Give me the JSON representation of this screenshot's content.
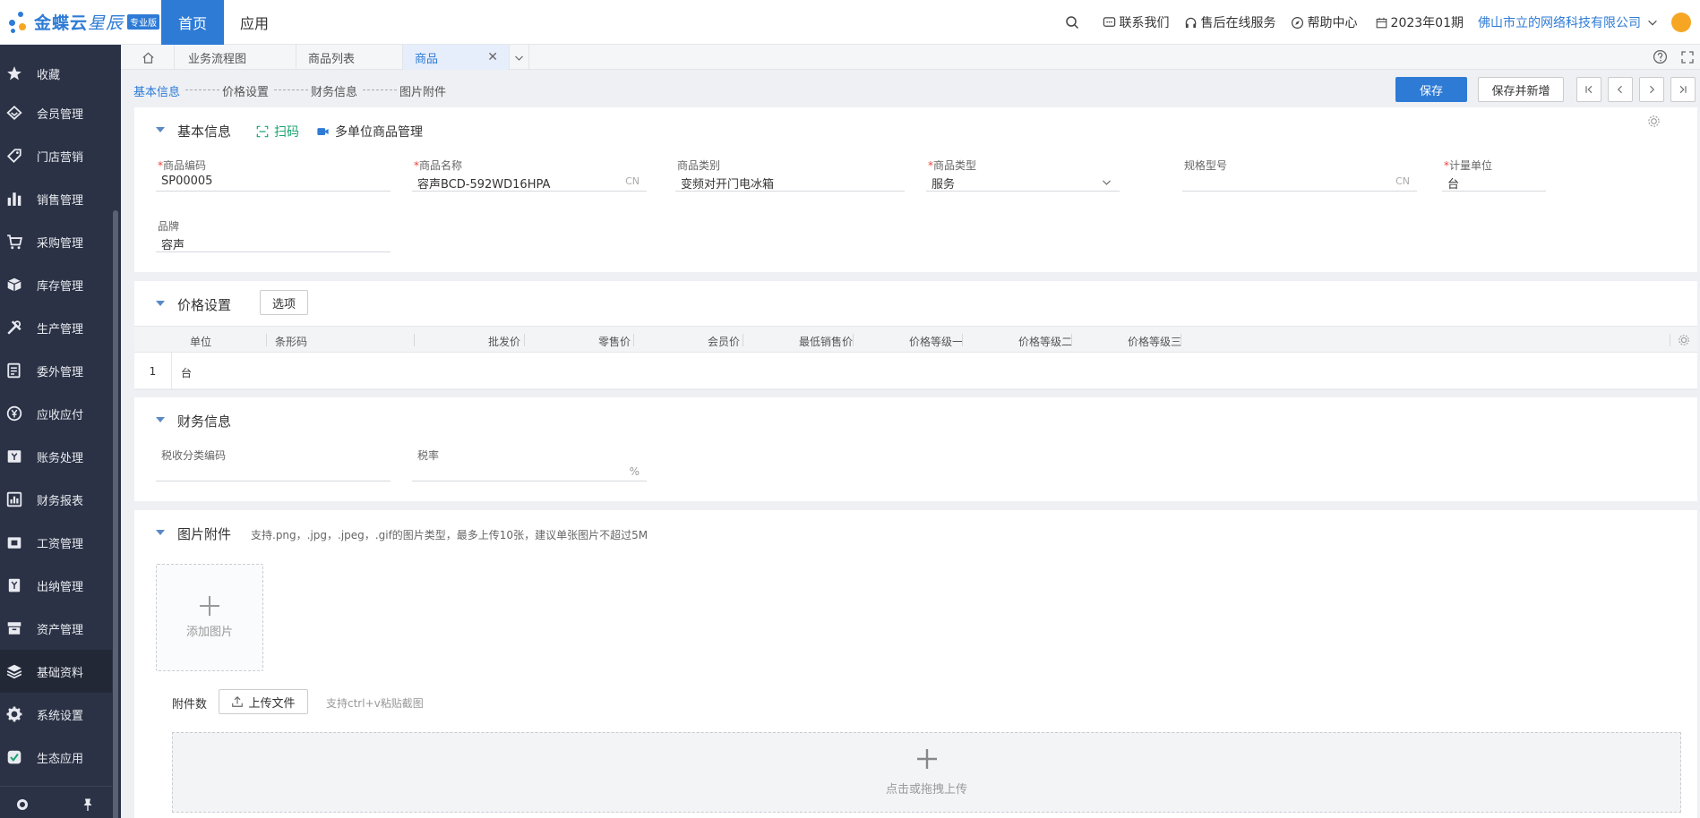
{
  "header": {
    "logo_text": "金蝶云",
    "logo_star": "星辰",
    "logo_badge": "专业版",
    "nav_home": "首页",
    "nav_app": "应用",
    "contact": "联系我们",
    "service": "售后在线服务",
    "help": "帮助中心",
    "period": "2023年01期",
    "company": "佛山市立的网络科技有限公司"
  },
  "sidebar": {
    "items": [
      {
        "label": "收藏",
        "icon": "star-icon"
      },
      {
        "label": "会员管理",
        "icon": "member-icon"
      },
      {
        "label": "门店营销",
        "icon": "tag-icon"
      },
      {
        "label": "销售管理",
        "icon": "bar-chart-icon"
      },
      {
        "label": "采购管理",
        "icon": "cart-icon"
      },
      {
        "label": "库存管理",
        "icon": "box-icon"
      },
      {
        "label": "生产管理",
        "icon": "tools-icon"
      },
      {
        "label": "委外管理",
        "icon": "document-icon"
      },
      {
        "label": "应收应付",
        "icon": "yen-coin-icon"
      },
      {
        "label": "账务处理",
        "icon": "ledger-icon"
      },
      {
        "label": "财务报表",
        "icon": "report-icon"
      },
      {
        "label": "工资管理",
        "icon": "wallet-icon"
      },
      {
        "label": "出纳管理",
        "icon": "cashier-icon"
      },
      {
        "label": "资产管理",
        "icon": "archive-icon"
      },
      {
        "label": "基础资料",
        "icon": "layers-icon"
      },
      {
        "label": "系统设置",
        "icon": "gear-icon"
      },
      {
        "label": "生态应用",
        "icon": "ecology-icon"
      }
    ],
    "active_index": 14
  },
  "tabs": [
    {
      "label": "业务流程图"
    },
    {
      "label": "商品列表"
    },
    {
      "label": "商品"
    }
  ],
  "steps": [
    "基本信息",
    "价格设置",
    "财务信息",
    "图片附件"
  ],
  "toolbar": {
    "save": "保存",
    "save_new": "保存并新增"
  },
  "basic": {
    "title": "基本信息",
    "scan": "扫码",
    "multi_unit": "多单位商品管理",
    "fields": {
      "code_label": "商品编码",
      "code_value": "SP00005",
      "name_label": "商品名称",
      "name_value": "容声BCD-592WD16HPA",
      "name_suffix": "CN",
      "category_label": "商品类别",
      "category_value": "变频对开门电冰箱",
      "type_label": "商品类型",
      "type_value": "服务",
      "spec_label": "规格型号",
      "spec_value": "",
      "spec_suffix": "CN",
      "unit_label": "计量单位",
      "unit_value": "台",
      "brand_label": "品牌",
      "brand_value": "容声"
    }
  },
  "price": {
    "title": "价格设置",
    "options": "选项",
    "columns": [
      "单位",
      "条形码",
      "批发价",
      "零售价",
      "会员价",
      "最低销售价",
      "价格等级一",
      "价格等级二",
      "价格等级三"
    ],
    "rows": [
      {
        "index": "1",
        "unit": "台"
      }
    ]
  },
  "finance": {
    "title": "财务信息",
    "tax_code_label": "税收分类编码",
    "tax_code_value": "",
    "tax_rate_label": "税率",
    "tax_rate_suffix": "%"
  },
  "images": {
    "title": "图片附件",
    "hint": "支持.png，.jpg，.jpeg，.gif的图片类型，最多上传10张，建议单张图片不超过5M",
    "add_image": "添加图片",
    "attach_label": "附件数",
    "upload_button": "上传文件",
    "paste_hint": "支持ctrl+v粘贴截图",
    "drop_text": "点击或拖拽上传"
  },
  "colors": {
    "brand": "#2e7bd6",
    "sidebar_bg": "#2b3245",
    "required": "#e8433d"
  }
}
